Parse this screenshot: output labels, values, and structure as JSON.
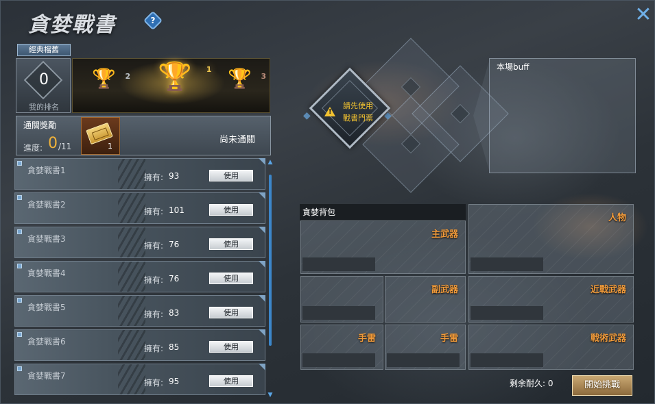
{
  "window": {
    "title": "貪婪戰書",
    "help_label": "?",
    "close_label": "✕"
  },
  "tabs": {
    "classic": "經典檔舊"
  },
  "rank": {
    "value": "0",
    "label": "我的排名"
  },
  "trophies": [
    {
      "rank": "2",
      "icon": "silver-trophy-icon"
    },
    {
      "rank": "1",
      "icon": "gold-trophy-icon"
    },
    {
      "rank": "3",
      "icon": "bronze-trophy-icon"
    }
  ],
  "reward": {
    "title": "通關獎勵",
    "progress_label": "進度:",
    "progress_value": "0",
    "progress_total": "/11",
    "item_qty": "1",
    "status": "尚未通關"
  },
  "books": [
    {
      "name": "貪婪戰書1",
      "own_label": "擁有:",
      "own": "93",
      "button": "使用"
    },
    {
      "name": "貪婪戰書2",
      "own_label": "擁有:",
      "own": "101",
      "button": "使用"
    },
    {
      "name": "貪婪戰書3",
      "own_label": "擁有:",
      "own": "76",
      "button": "使用"
    },
    {
      "name": "貪婪戰書4",
      "own_label": "擁有:",
      "own": "76",
      "button": "使用"
    },
    {
      "name": "貪婪戰書5",
      "own_label": "擁有:",
      "own": "83",
      "button": "使用"
    },
    {
      "name": "貪婪戰書6",
      "own_label": "擁有:",
      "own": "85",
      "button": "使用"
    },
    {
      "name": "貪婪戰書7",
      "own_label": "擁有:",
      "own": "95",
      "button": "使用"
    }
  ],
  "ticket_slot": {
    "line1": "請先使用",
    "line2": "戰書門票"
  },
  "buff": {
    "title": "本場buff"
  },
  "backpack": {
    "title": "貪婪背包",
    "slots": {
      "primary": "主武器",
      "character": "人物",
      "secondary": "副武器",
      "melee": "近戰武器",
      "grenade1": "手雷",
      "grenade2": "手雷",
      "tactical": "戰術武器"
    }
  },
  "footer": {
    "durability_label": "剩余耐久:",
    "durability_value": "0",
    "start_button": "開始挑戰"
  },
  "colors": {
    "accent_gold": "#f0b23a",
    "weapon_label": "#f09a3a",
    "warning": "#f2c230",
    "close": "#6fb0e8"
  }
}
